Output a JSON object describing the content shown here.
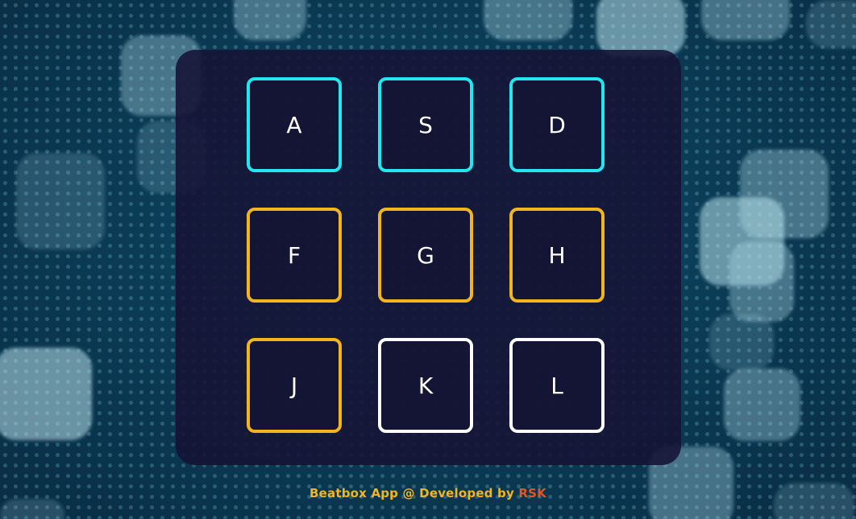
{
  "app": {
    "keys": [
      {
        "label": "A",
        "border_color": "#22e7ee"
      },
      {
        "label": "S",
        "border_color": "#22e7ee"
      },
      {
        "label": "D",
        "border_color": "#22e7ee"
      },
      {
        "label": "F",
        "border_color": "#f3b51f"
      },
      {
        "label": "G",
        "border_color": "#f3b51f"
      },
      {
        "label": "H",
        "border_color": "#f3b51f"
      },
      {
        "label": "J",
        "border_color": "#f3b51f"
      },
      {
        "label": "K",
        "border_color": "#ffffff"
      },
      {
        "label": "L",
        "border_color": "#ffffff"
      }
    ]
  },
  "footer": {
    "text": "Beatbox App @ Developed by ",
    "author": "RSK",
    "text_color": "#f3b51f",
    "author_color": "#e2562a"
  },
  "colors": {
    "panel_background": "#161434",
    "background": "#0b3d57"
  }
}
